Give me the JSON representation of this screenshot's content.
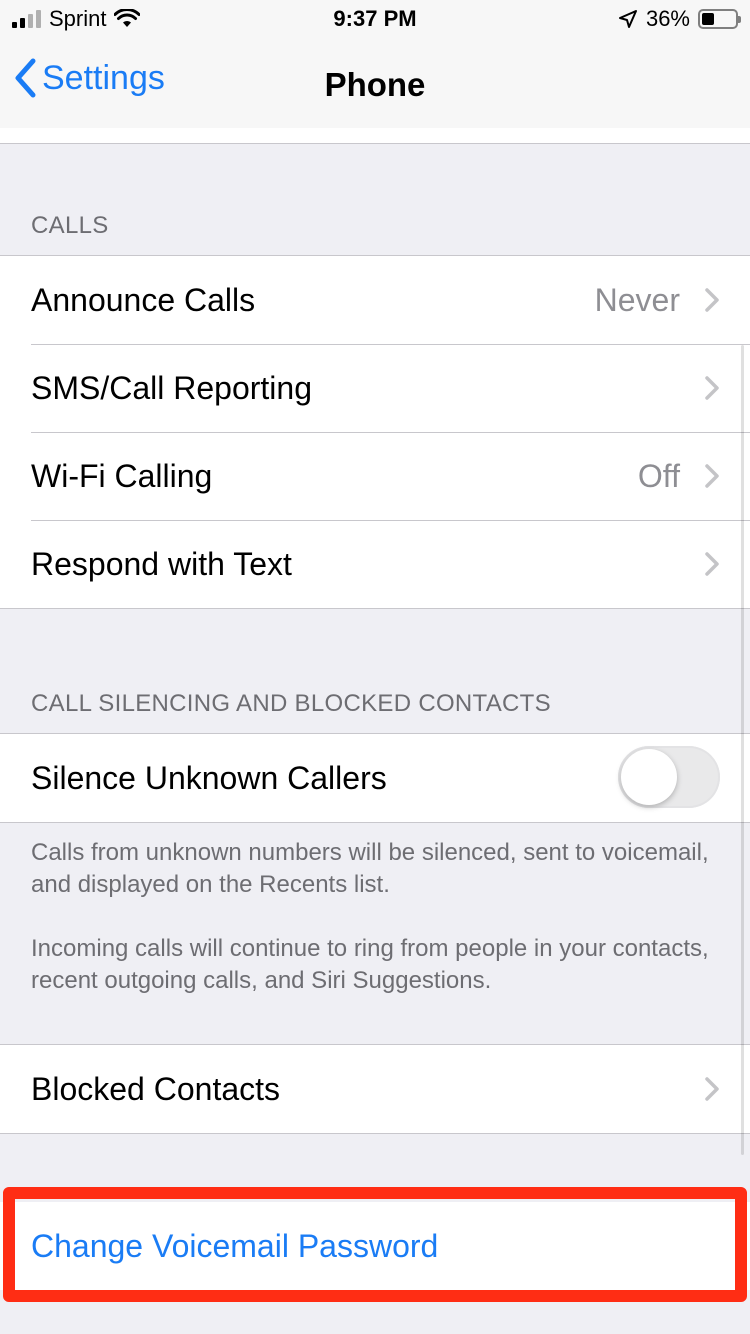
{
  "status_bar": {
    "carrier": "Sprint",
    "time": "9:37 PM",
    "battery": "36%",
    "battery_level": 0.36,
    "icons": [
      "signal-icon",
      "wifi-icon",
      "location-icon",
      "battery-icon"
    ]
  },
  "nav": {
    "back_label": "Settings",
    "title": "Phone"
  },
  "calls": {
    "header": "CALLS",
    "rows": [
      {
        "label": "Announce Calls",
        "value": "Never"
      },
      {
        "label": "SMS/Call Reporting",
        "value": ""
      },
      {
        "label": "Wi-Fi Calling",
        "value": "Off"
      },
      {
        "label": "Respond with Text",
        "value": ""
      }
    ]
  },
  "silencing": {
    "header": "CALL SILENCING AND BLOCKED CONTACTS",
    "silence_label": "Silence Unknown Callers",
    "silence_on": false,
    "footer_1": "Calls from unknown numbers will be silenced, sent to voicemail, and displayed on the Recents list.",
    "footer_2": "Incoming calls will continue to ring from people in your contacts, recent outgoing calls, and Siri Suggestions.",
    "blocked_label": "Blocked Contacts"
  },
  "voicemail": {
    "change_password_label": "Change Voicemail Password"
  },
  "colors": {
    "accent": "#1a7cf5",
    "highlight": "#ff2d14",
    "background": "#efeff4"
  }
}
